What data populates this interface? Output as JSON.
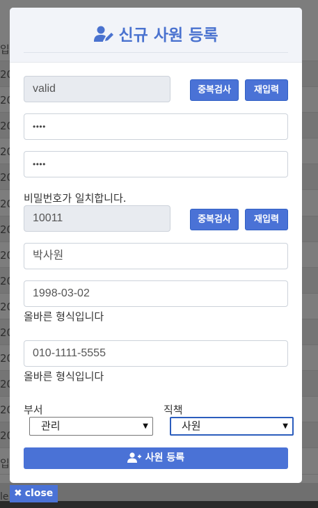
{
  "background": {
    "header_cell": "입",
    "row_cells": [
      "20",
      "20",
      "20",
      "20",
      "20",
      "20",
      "20",
      "20",
      "20",
      "20",
      "20",
      "20",
      "20",
      "20",
      "20"
    ],
    "last_row_cell": "입",
    "bottom_text": "le"
  },
  "modal": {
    "title": "신규 사원 등록",
    "title_icon": "user-edit-icon",
    "id_field": {
      "value": "valid"
    },
    "check_dup_label": "중복검사",
    "reenter_label": "재입력",
    "password": {
      "value": "••••"
    },
    "password_confirm": {
      "value": "••••"
    },
    "password_message": "비밀번호가 일치합니다.",
    "emp_no_field": {
      "value": "10011"
    },
    "check_dup_label_2": "중복검사",
    "reenter_label_2": "재입력",
    "name_field": {
      "value": "박사원"
    },
    "birth_field": {
      "value": "1998-03-02"
    },
    "birth_message": "올바른 형식입니다",
    "phone_field": {
      "value": "010-1111-5555"
    },
    "phone_message": "올바른 형식입니다",
    "dept_label": "부서",
    "dept_selected": "관리",
    "position_label": "직책",
    "position_selected": "사원",
    "submit_label": "사원 등록",
    "submit_icon": "user-plus-icon"
  },
  "close_button": {
    "label": "close",
    "icon": "close-icon"
  },
  "colors": {
    "accent": "#4a72d6",
    "title": "#4a72cf"
  }
}
